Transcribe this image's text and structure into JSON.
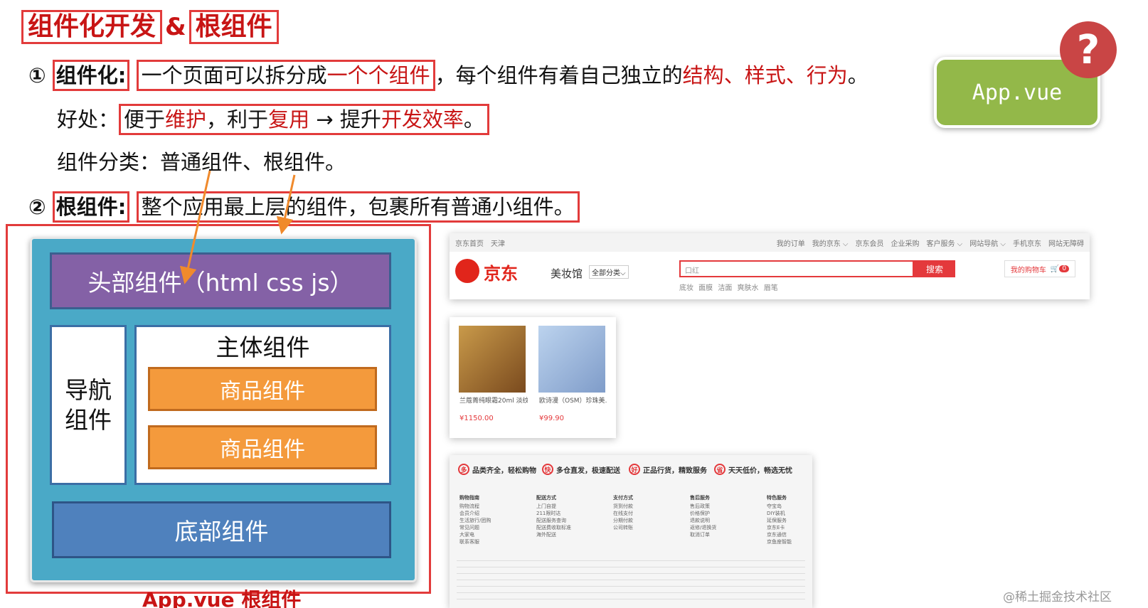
{
  "title": {
    "part1": "组件化开发",
    "amp": "&",
    "part2": "根组件"
  },
  "line1": {
    "num": "①",
    "label": "组件化",
    "colon": ":",
    "text_a": "一个页面可以拆分成",
    "text_b": "一个个组件",
    "text_c": "，每个组件有着自己独立的",
    "struct": "结构",
    "sep1": "、",
    "style": "样式",
    "sep2": "、",
    "behavior": "行为",
    "end": "。"
  },
  "line2": {
    "prefix": "好处：",
    "a": "便于",
    "b": "维护",
    "c": "，利于",
    "d": "复用",
    "e": " → 提升",
    "f": "开发效率",
    "g": "。"
  },
  "line3": {
    "text": "组件分类：普通组件、根组件。"
  },
  "line4": {
    "num": "②",
    "label": "根组件",
    "colon": ":",
    "text": "整个应用最上层的组件，包裹所有普通小组件。"
  },
  "badge": {
    "label": "App.vue",
    "qmark": "?"
  },
  "diagram": {
    "header": "头部组件（html css js）",
    "nav_line1": "导航",
    "nav_line2": "组件",
    "main": "主体组件",
    "goods": [
      "商品组件",
      "商品组件"
    ],
    "footer": "底部组件",
    "caption": "App.vue 根组件"
  },
  "jd": {
    "topbar_left": [
      "京东首页",
      "天津"
    ],
    "topbar_right": [
      "我的订单",
      "我的京东 ⌵",
      "京东会员",
      "企业采购",
      "客户服务 ⌵",
      "网站导航 ⌵",
      "手机京东",
      "网站无障碍"
    ],
    "logo": "京东",
    "channel": "美妆馆",
    "all_categories": "全部分类⌵",
    "search_value": "口红",
    "search_button": "搜索",
    "hotwords": "底妆 面膜 洁面 爽肤水 眉笔",
    "cart": "我的购物车",
    "cart_count": "0",
    "goods": [
      {
        "name": "兰蔻菁纯眼霜20ml 淡纹...",
        "price": "¥1150.00"
      },
      {
        "name": "欧诗漫（OSM）珍珠美...",
        "price": "¥99.90"
      }
    ],
    "promises": [
      {
        "icon": "多",
        "text": "品类齐全，轻松购物"
      },
      {
        "icon": "快",
        "text": "多仓直发，极速配送"
      },
      {
        "icon": "好",
        "text": "正品行货，精致服务"
      },
      {
        "icon": "省",
        "text": "天天低价，畅选无忧"
      }
    ],
    "footer_cols": [
      {
        "head": "购物指南",
        "items": [
          "购物流程",
          "会员介绍",
          "生活旅行/团购",
          "常见问题",
          "大家电",
          "联系客服"
        ]
      },
      {
        "head": "配送方式",
        "items": [
          "上门自提",
          "211限时达",
          "配送服务查询",
          "配送费收取标准",
          "海外配送"
        ]
      },
      {
        "head": "支付方式",
        "items": [
          "货到付款",
          "在线支付",
          "分期付款",
          "公司转账"
        ]
      },
      {
        "head": "售后服务",
        "items": [
          "售后政策",
          "价格保护",
          "退款说明",
          "返修/退换货",
          "取消订单"
        ]
      },
      {
        "head": "特色服务",
        "items": [
          "夺宝岛",
          "DIY装机",
          "延保服务",
          "京东E卡",
          "京东通信",
          "京鱼座智能"
        ]
      }
    ]
  },
  "watermark": "@稀土掘金技术社区",
  "colors": {
    "accent_red": "#c81515",
    "box_red": "#e23b3b",
    "badge_green": "#93b849",
    "teal": "#4aa9c7"
  }
}
